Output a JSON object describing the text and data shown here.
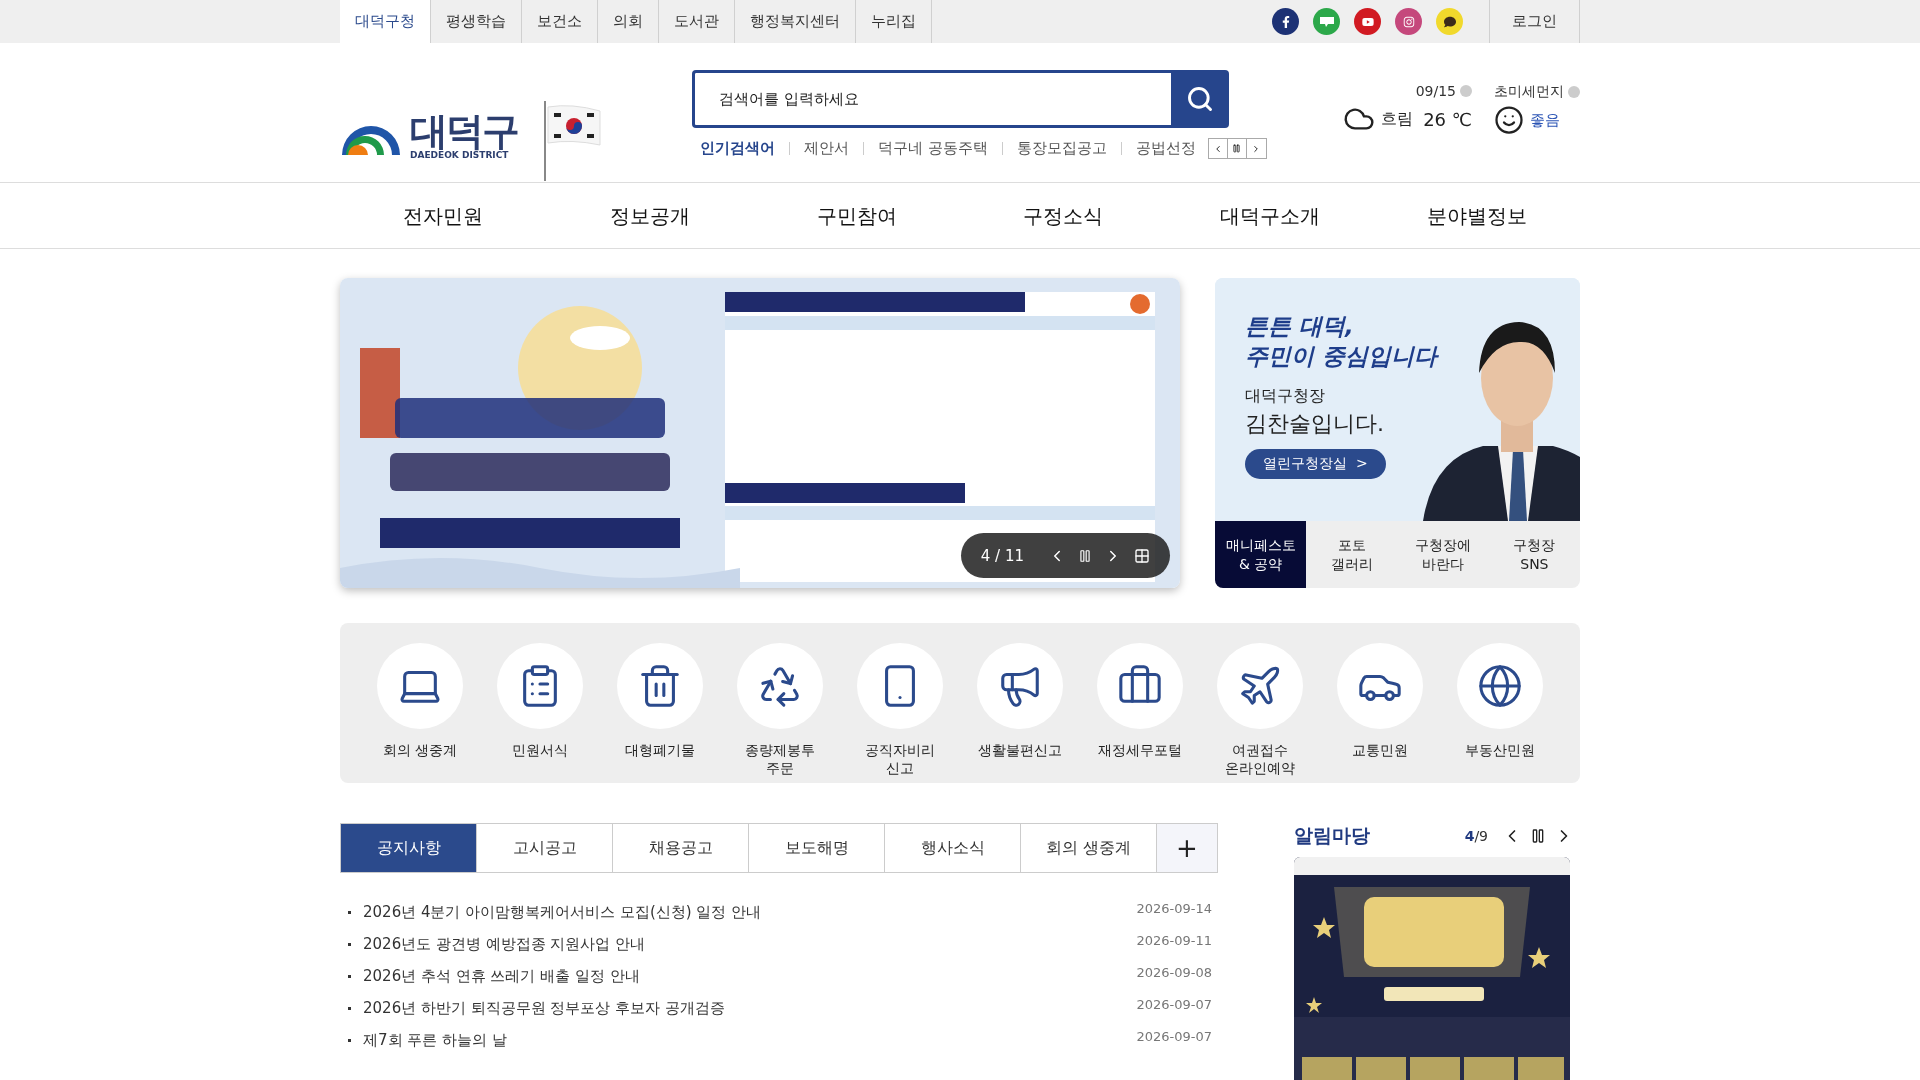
{
  "top_bar": {
    "sites": [
      {
        "label": "대덕구청",
        "selected": true
      },
      {
        "label": "평생학습",
        "selected": false
      },
      {
        "label": "보건소",
        "selected": false
      },
      {
        "label": "의회",
        "selected": false
      },
      {
        "label": "도서관",
        "selected": false
      },
      {
        "label": "행정복지센터",
        "selected": false
      },
      {
        "label": "누리집",
        "selected": false
      }
    ],
    "social": [
      {
        "kind": "facebook",
        "color": "#1d3275"
      },
      {
        "kind": "blog",
        "color": "#2ca84a"
      },
      {
        "kind": "youtube",
        "color": "#d11a22"
      },
      {
        "kind": "instagram",
        "color": "#c5487c"
      },
      {
        "kind": "talk",
        "color": "#f1d92c"
      }
    ],
    "login": "로그인"
  },
  "header": {
    "logo": {
      "name": "대덕구",
      "subtitle": "DAEDEOK DISTRICT"
    },
    "search": {
      "placeholder": "검색어를 입력하세요"
    },
    "popular": {
      "label": "인기검색어",
      "terms": [
        "제안서",
        "덕구네 공동주택",
        "통장모집공고",
        "공법선정"
      ]
    },
    "weather": {
      "date": "09/15",
      "condition": "흐림",
      "temperature": "26 ℃"
    },
    "air": {
      "label": "초미세먼지",
      "status": "좋음"
    }
  },
  "nav": [
    "전자민원",
    "정보공개",
    "구민참여",
    "구정소식",
    "대덕구소개",
    "분야별정보"
  ],
  "banner": {
    "kind": "picture",
    "counter": "4 / 11"
  },
  "mayor": {
    "slogan": [
      "튼튼 대덕,",
      "주민이 중심입니다"
    ],
    "title": "대덕구청장",
    "name": "김찬술입니다.",
    "button": "열린구청장실  >",
    "tabs": [
      {
        "label": "매니페스토\n& 공약",
        "selected": true
      },
      {
        "label": "포토\n갤러리",
        "selected": false
      },
      {
        "label": "구청장에\n바란다",
        "selected": false
      },
      {
        "label": "구청장\nSNS",
        "selected": false
      }
    ]
  },
  "quick_links": [
    {
      "label": "회의 생중계",
      "kind": "laptop"
    },
    {
      "label": "민원서식",
      "kind": "clipboard"
    },
    {
      "label": "대형폐기물",
      "kind": "trash"
    },
    {
      "label": "종량제봉투\n주문",
      "kind": "recycle"
    },
    {
      "label": "공직자비리\n신고",
      "kind": "phones"
    },
    {
      "label": "생활불편신고",
      "kind": "megaphone"
    },
    {
      "label": "재정세무포털",
      "kind": "briefcase"
    },
    {
      "label": "여권접수\n온라인예약",
      "kind": "plane"
    },
    {
      "label": "교통민원",
      "kind": "car"
    },
    {
      "label": "부동산민원",
      "kind": "globe"
    }
  ],
  "board": {
    "tabs": [
      {
        "label": "공지사항",
        "selected": true
      },
      {
        "label": "고시공고",
        "selected": false
      },
      {
        "label": "채용공고",
        "selected": false
      },
      {
        "label": "보도해명",
        "selected": false
      },
      {
        "label": "행사소식",
        "selected": false
      },
      {
        "label": "회의 생중계",
        "selected": false
      }
    ],
    "more": "+",
    "posts": [
      {
        "title": "2026년 4분기 아이맘행복케어서비스 모집(신청) 일정 안내",
        "date": "2026-09-14"
      },
      {
        "title": "2026년도 광견병 예방접종 지원사업 안내",
        "date": "2026-09-11"
      },
      {
        "title": "2026년 추석 연휴 쓰레기 배출 일정 안내",
        "date": "2026-09-08"
      },
      {
        "title": "2026년 하반기 퇴직공무원 정부포상 후보자 공개검증",
        "date": "2026-09-07"
      },
      {
        "title": "제7회 푸른 하늘의 날",
        "date": "2026-09-07"
      }
    ]
  },
  "notice_board": {
    "title": "알림마당",
    "counter": "**4**/9"
  }
}
